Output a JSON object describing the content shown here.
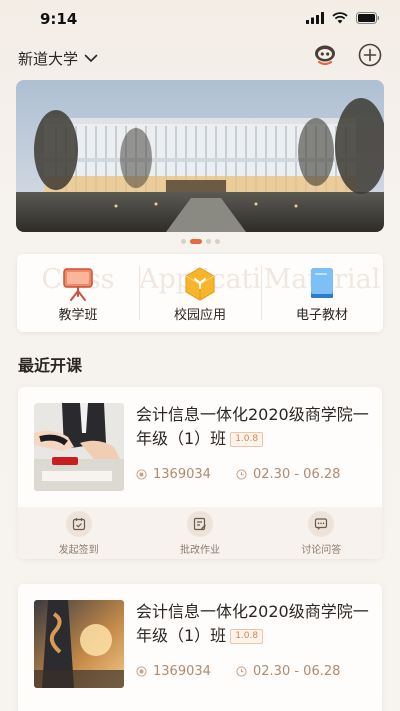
{
  "status_bar": {
    "time": "9:14"
  },
  "header": {
    "school_name": "新道大学"
  },
  "quick_nav": [
    {
      "label": "教学班",
      "ghost": "Class",
      "icon": "presentation-board-icon"
    },
    {
      "label": "校园应用",
      "ghost": "Application",
      "icon": "cube-app-icon"
    },
    {
      "label": "电子教材",
      "ghost": "Material",
      "icon": "book-icon"
    }
  ],
  "section": {
    "title": "最近开课"
  },
  "courses": [
    {
      "title": "会计信息一体化2020级商学院一年级（1）班",
      "version": "1.0.8",
      "code": "1369034",
      "dates": "02.30 - 06.28",
      "actions": [
        "发起签到",
        "批改作业",
        "讨论问答"
      ]
    },
    {
      "title": "会计信息一体化2020级商学院一年级（1）班",
      "version": "1.0.8",
      "code": "1369034",
      "dates": "02.30 - 06.28"
    }
  ],
  "colors": {
    "accent": "#e56a3c",
    "meta_text": "#b08a6e",
    "card_bg": "#fffdfb"
  }
}
